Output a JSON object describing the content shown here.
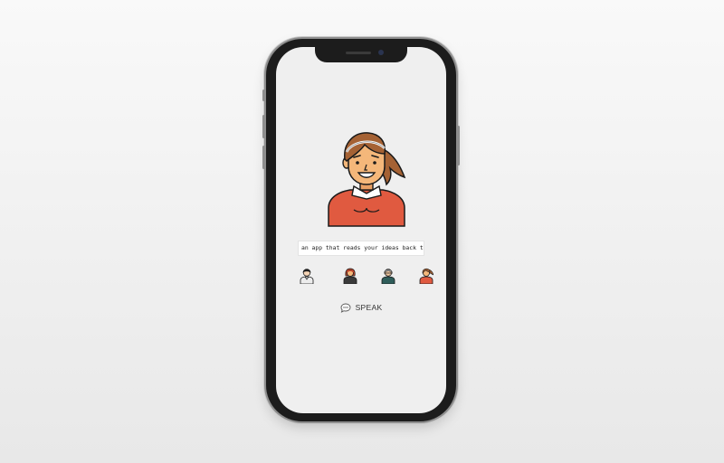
{
  "prompt": {
    "value": "an app that reads your ideas back to…"
  },
  "avatar": {
    "icon": "woman-ponytail-avatar-icon",
    "colors": {
      "hair": "#a56234",
      "skin": "#f4b77a",
      "sweater": "#e05a40"
    }
  },
  "voices": [
    {
      "icon": "man-avatar-icon"
    },
    {
      "icon": "woman-red-hair-avatar-icon"
    },
    {
      "icon": "elderly-man-avatar-icon"
    },
    {
      "icon": "woman-ponytail-avatar-icon"
    }
  ],
  "speak": {
    "label": "SPEAK",
    "icon": "speech-bubble-icon"
  }
}
